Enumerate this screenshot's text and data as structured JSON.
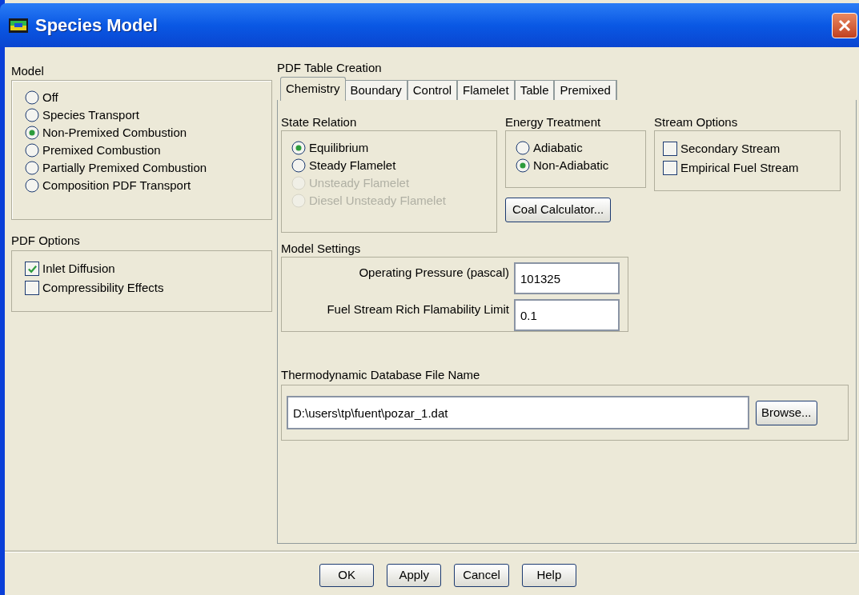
{
  "window": {
    "title": "Species Model"
  },
  "model": {
    "label": "Model",
    "options": [
      {
        "label": "Off",
        "selected": false
      },
      {
        "label": "Species Transport",
        "selected": false
      },
      {
        "label": "Non-Premixed Combustion",
        "selected": true
      },
      {
        "label": "Premixed Combustion",
        "selected": false
      },
      {
        "label": "Partially Premixed Combustion",
        "selected": false
      },
      {
        "label": "Composition PDF Transport",
        "selected": false
      }
    ]
  },
  "pdf_options": {
    "label": "PDF Options",
    "items": [
      {
        "label": "Inlet Diffusion",
        "checked": true
      },
      {
        "label": "Compressibility Effects",
        "checked": false
      }
    ]
  },
  "pdf_table_creation": {
    "label": "PDF Table Creation",
    "tabs": [
      {
        "label": "Chemistry",
        "selected": true
      },
      {
        "label": "Boundary",
        "selected": false
      },
      {
        "label": "Control",
        "selected": false
      },
      {
        "label": "Flamelet",
        "selected": false
      },
      {
        "label": "Table",
        "selected": false
      },
      {
        "label": "Premixed",
        "selected": false
      }
    ],
    "state_relation": {
      "label": "State Relation",
      "options": [
        {
          "label": "Equilibrium",
          "selected": true,
          "disabled": false
        },
        {
          "label": "Steady Flamelet",
          "selected": false,
          "disabled": false
        },
        {
          "label": "Unsteady Flamelet",
          "selected": false,
          "disabled": true
        },
        {
          "label": "Diesel Unsteady Flamelet",
          "selected": false,
          "disabled": true
        }
      ]
    },
    "energy_treatment": {
      "label": "Energy Treatment",
      "options": [
        {
          "label": "Adiabatic",
          "selected": false
        },
        {
          "label": "Non-Adiabatic",
          "selected": true
        }
      ]
    },
    "coal_calculator_button": "Coal Calculator...",
    "stream_options": {
      "label": "Stream Options",
      "items": [
        {
          "label": "Secondary Stream",
          "checked": false
        },
        {
          "label": "Empirical Fuel Stream",
          "checked": false
        }
      ]
    },
    "model_settings": {
      "label": "Model Settings",
      "fields": [
        {
          "label": "Operating Pressure (pascal)",
          "value": "101325"
        },
        {
          "label": "Fuel Stream Rich Flamability Limit",
          "value": "0.1"
        }
      ]
    },
    "thermo_database": {
      "label": "Thermodynamic Database File Name",
      "value": "D:\\users\\tp\\fuent\\pozar_1.dat",
      "browse_button": "Browse..."
    }
  },
  "buttons": [
    "OK",
    "Apply",
    "Cancel",
    "Help"
  ]
}
